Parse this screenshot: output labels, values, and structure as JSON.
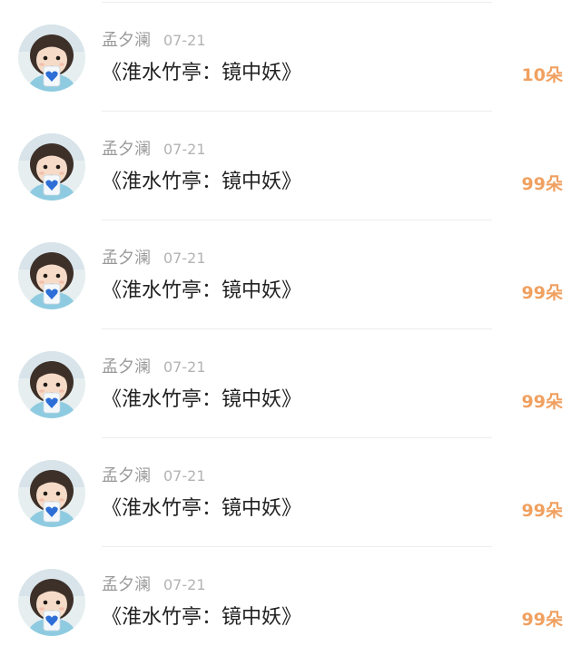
{
  "records": [
    {
      "name": "孟夕澜",
      "date": "07-21",
      "title": "《淮水竹亭：镜中妖》",
      "amount": "10朵"
    },
    {
      "name": "孟夕澜",
      "date": "07-21",
      "title": "《淮水竹亭：镜中妖》",
      "amount": "99朵"
    },
    {
      "name": "孟夕澜",
      "date": "07-21",
      "title": "《淮水竹亭：镜中妖》",
      "amount": "99朵"
    },
    {
      "name": "孟夕澜",
      "date": "07-21",
      "title": "《淮水竹亭：镜中妖》",
      "amount": "99朵"
    },
    {
      "name": "孟夕澜",
      "date": "07-21",
      "title": "《淮水竹亭：镜中妖》",
      "amount": "99朵"
    },
    {
      "name": "孟夕澜",
      "date": "07-21",
      "title": "《淮水竹亭：镜中妖》",
      "amount": "99朵"
    }
  ],
  "colors": {
    "name": "#9a9a9a",
    "date": "#b3b3b3",
    "title": "#222222",
    "amount": "#f0a060",
    "divider": "#eeeeee"
  },
  "icons": {
    "avatar": "child-with-blue-heart-avatar"
  }
}
